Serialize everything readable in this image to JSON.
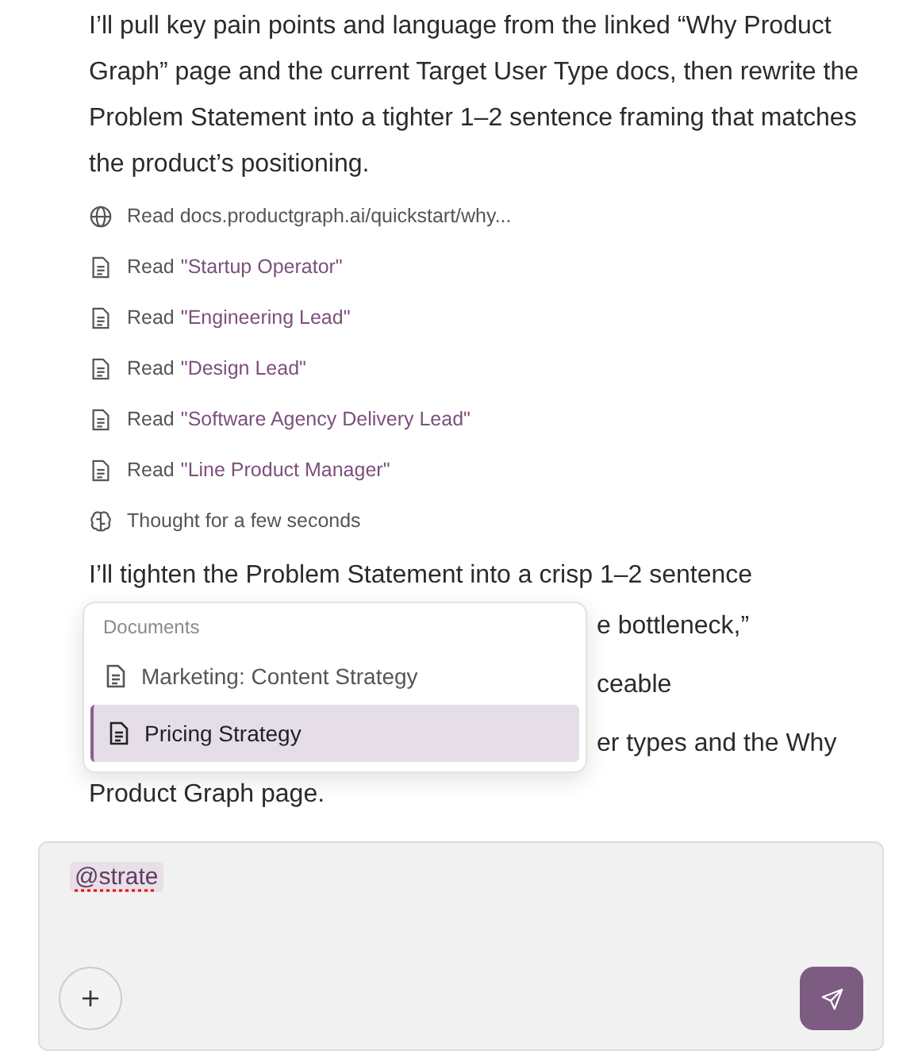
{
  "intro": "I’ll pull key pain points and language from the linked “Why Product Graph” page and the current Target User Type docs, then rewrite the Problem Statement into a tighter 1–2 sentence framing that matches the product’s positioning.",
  "steps": [
    {
      "kind": "web",
      "label": "Read docs.productgraph.ai/quickstart/why..."
    },
    {
      "kind": "doc",
      "label": "Read",
      "target": "\"Startup Operator\""
    },
    {
      "kind": "doc",
      "label": "Read",
      "target": "\"Engineering Lead\""
    },
    {
      "kind": "doc",
      "label": "Read",
      "target": "\"Design Lead\""
    },
    {
      "kind": "doc",
      "label": "Read",
      "target": "\"Software Agency Delivery Lead\""
    },
    {
      "kind": "doc",
      "label": "Read",
      "target": "\"Line Product Manager\""
    },
    {
      "kind": "thought",
      "label": "Thought for a few seconds"
    }
  ],
  "reply_lines": [
    "I’ll tighten the Problem Statement into a crisp 1–2 sentence",
    "e bottleneck,”",
    "ceable",
    "er types and the Why",
    "Product Graph page."
  ],
  "mention_menu": {
    "heading": "Documents",
    "items": [
      {
        "label": "Marketing: Content Strategy",
        "selected": false
      },
      {
        "label": "Pricing Strategy",
        "selected": true
      }
    ]
  },
  "composer": {
    "value": "@strate"
  }
}
